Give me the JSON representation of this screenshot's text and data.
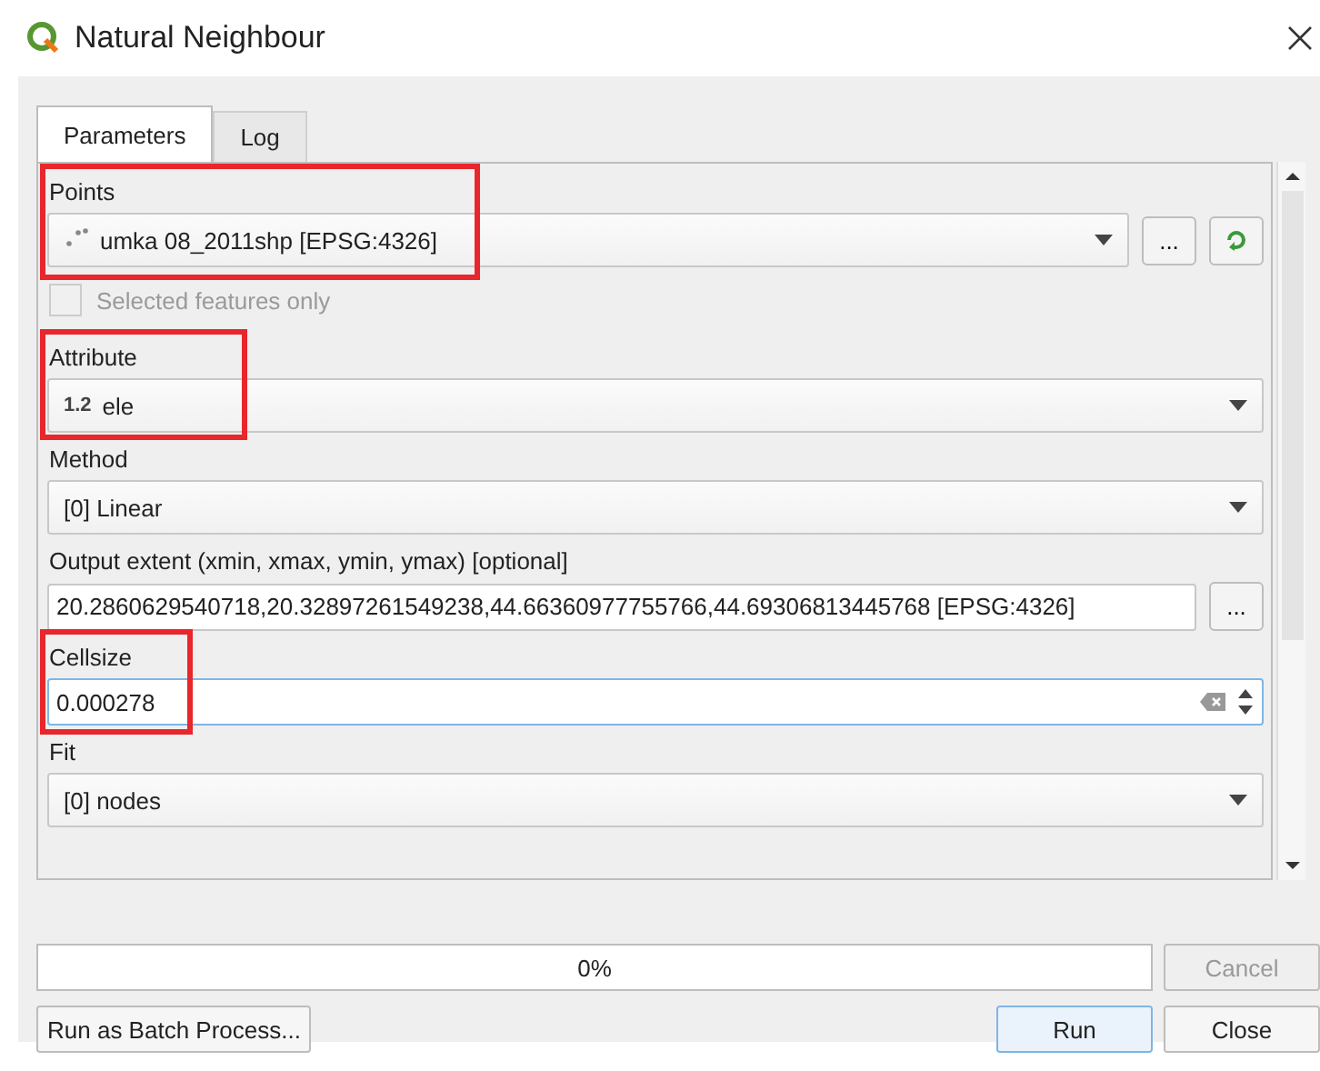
{
  "window": {
    "title": "Natural Neighbour"
  },
  "tabs": [
    {
      "label": "Parameters",
      "selected": true
    },
    {
      "label": "Log",
      "selected": false
    }
  ],
  "parameters": [
    {
      "kind": "layer",
      "label": "Points",
      "value": "umka 08_2011shp [EPSG:4326]",
      "button": "...",
      "highlighted": true
    },
    {
      "kind": "checkbox",
      "label": "Selected features only",
      "checked": false,
      "disabled": true
    },
    {
      "kind": "field-combo",
      "label": "Attribute",
      "type_badge": "1.2",
      "value": "ele",
      "highlighted": true
    },
    {
      "kind": "combo",
      "label": "Method",
      "value": "[0] Linear",
      "highlighted": false
    },
    {
      "kind": "extent",
      "label": "Output extent (xmin, xmax, ymin, ymax) [optional]",
      "value": "20.2860629540718,20.32897261549238,44.66360977755766,44.69306813445768 [EPSG:4326]",
      "button": "..."
    },
    {
      "kind": "spin",
      "label": "Cellsize",
      "value": "0.000278",
      "highlighted": true
    },
    {
      "kind": "combo",
      "label": "Fit",
      "value": "[0] nodes",
      "highlighted": false
    }
  ],
  "progress": {
    "level": 0,
    "text": "0%"
  },
  "cancel_button": {
    "label": "Cancel",
    "disabled": true
  },
  "buttons": [
    {
      "label": "Run as Batch Process...",
      "default": false
    },
    {
      "label": "Run",
      "default": true
    },
    {
      "label": "Close",
      "default": false
    }
  ]
}
